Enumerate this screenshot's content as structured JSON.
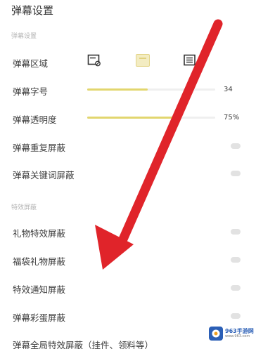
{
  "title": "弹幕设置",
  "sections": {
    "danmaku": "弹幕设置",
    "effects": "特效屏蔽"
  },
  "rows": {
    "area": "弹幕区域",
    "font_size": "弹幕字号",
    "opacity": "弹幕透明度",
    "repeat_block": "弹幕重复屏蔽",
    "keyword_block": "弹幕关键词屏蔽",
    "gift_effect": "礼物特效屏蔽",
    "lucky_bag": "福袋礼物屏蔽",
    "effect_notice": "特效通知屏蔽",
    "easter_egg": "弹幕彩蛋屏蔽",
    "global_effect": "弹幕全局特效屏蔽（挂件、领料等）"
  },
  "area_options": [
    {
      "icon": "no-danmaku-area-icon",
      "selected": false
    },
    {
      "icon": "half-screen-area-icon",
      "selected": true
    },
    {
      "icon": "full-screen-area-icon",
      "selected": false
    }
  ],
  "sliders": {
    "font_size": {
      "value": "34",
      "fraction": 0.47
    },
    "opacity": {
      "value": "75%",
      "fraction": 0.72
    }
  },
  "toggles": {
    "repeat_block": false,
    "keyword_block": false,
    "gift_effect": false,
    "lucky_bag": false,
    "effect_notice": false,
    "easter_egg": false
  },
  "watermark": {
    "text": "963手游网",
    "sub": "www.963.com"
  },
  "colors": {
    "accent": "#e2d66e",
    "arrow": "#e0242a",
    "section": "#b4b4b4"
  }
}
